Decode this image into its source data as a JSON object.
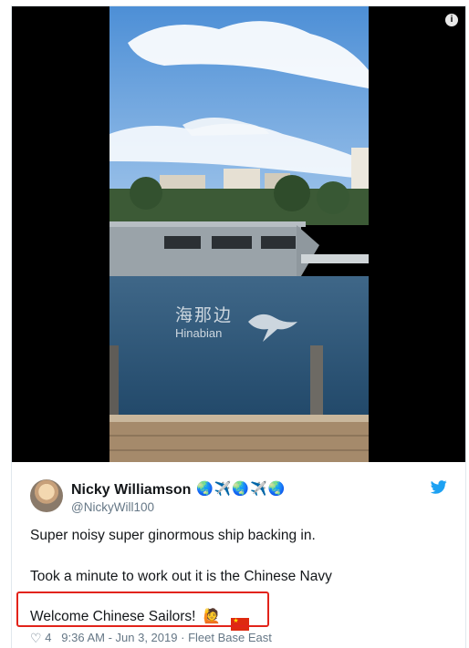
{
  "video": {
    "watermark_cn": "海那边",
    "watermark_en": "Hinabian",
    "info_icon": "info-icon"
  },
  "tweet": {
    "author_name": "Nicky Williamson",
    "author_badges": "🌏✈️🌏✈️🌏",
    "author_handle": "@NickyWill100",
    "line1": "Super noisy super ginormous ship backing in.",
    "line2": "Took a minute to work out it is the Chinese Navy",
    "line3": "Welcome Chinese Sailors!",
    "line3_emoji": "🙋",
    "like_count": "4",
    "timestamp": "9:36 AM - Jun 3, 2019",
    "separator": "·",
    "location": "Fleet Base East",
    "brand_icon": "twitter-bird-icon",
    "colors": {
      "twitter_blue": "#1da1f2",
      "highlight_red": "#e2231a",
      "meta_gray": "#657786"
    }
  }
}
